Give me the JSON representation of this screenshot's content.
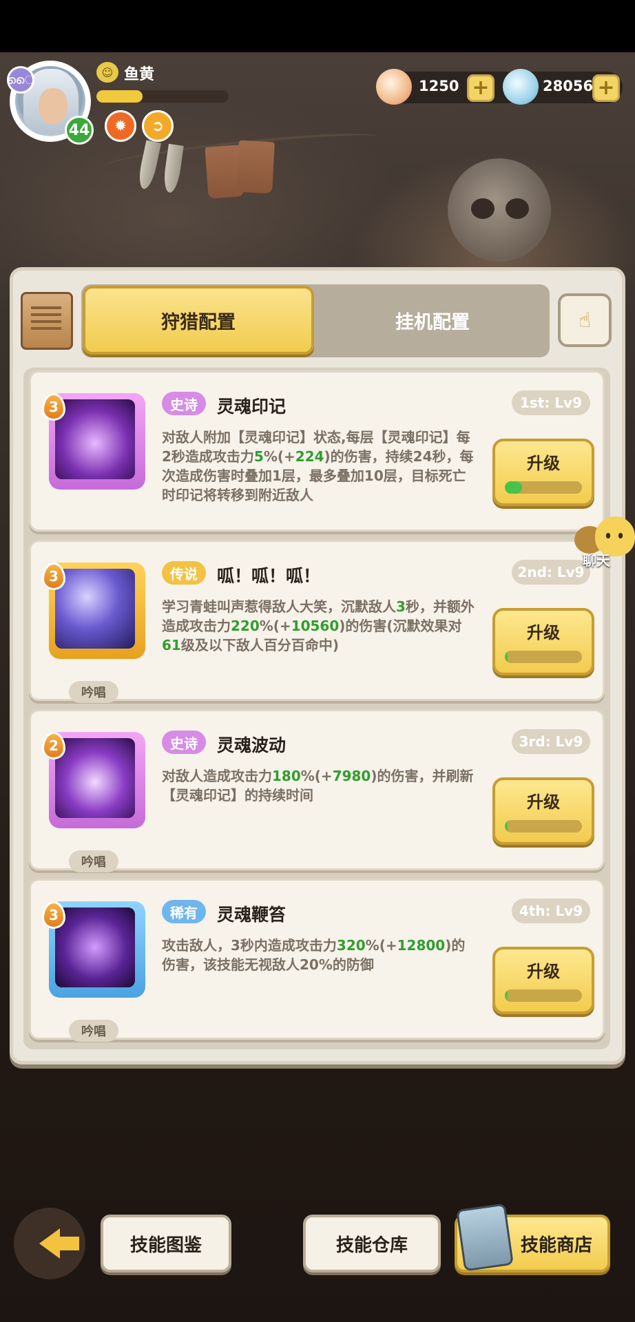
{
  "player": {
    "name": "鱼黄",
    "level": "44",
    "exp_fraction": 0.35
  },
  "currencies": [
    {
      "icon": "shell-icon",
      "value": "1250"
    },
    {
      "icon": "pearl-icon",
      "value": "28056"
    }
  ],
  "add_symbol": "+",
  "tabs": {
    "active": "狩猎配置",
    "inactive": "挂机配置"
  },
  "chat": {
    "label": "聊天"
  },
  "upgrade_label": "升级",
  "chant_label": "吟唱",
  "skills": [
    {
      "level": "3",
      "rarity": "史诗",
      "rarity_color": "#d68ce6",
      "name": "灵魂印记",
      "slot": "1st: Lv9",
      "has_chant": false,
      "progress": 0.22,
      "desc": [
        {
          "t": "对敌人附加【灵魂印记】状态,每层【灵魂印记】每2秒造成攻击力"
        },
        {
          "t": "5",
          "g": true
        },
        {
          "t": "%(+"
        },
        {
          "t": "224",
          "g": true
        },
        {
          "t": ")的伤害，持续24秒，每次造成伤害时叠加1层，最多叠加10层，目标死亡时印记将转移到附近敌人"
        }
      ]
    },
    {
      "level": "3",
      "rarity": "传说",
      "rarity_color": "#f1c244",
      "name": "呱！呱！呱！",
      "slot": "2nd: Lv9",
      "has_chant": true,
      "progress": 0.04,
      "desc": [
        {
          "t": "学习青蛙叫声惹得敌人大笑，沉默敌人"
        },
        {
          "t": "3",
          "g": true
        },
        {
          "t": "秒，并额外造成攻击力"
        },
        {
          "t": "220",
          "g": true
        },
        {
          "t": "%(+"
        },
        {
          "t": "10560",
          "g": true
        },
        {
          "t": ")的伤害(沉默效果对"
        },
        {
          "t": "61",
          "g": true
        },
        {
          "t": "级及以下敌人百分百命中)"
        }
      ]
    },
    {
      "level": "2",
      "rarity": "史诗",
      "rarity_color": "#d68ce6",
      "name": "灵魂波动",
      "slot": "3rd: Lv9",
      "has_chant": true,
      "progress": 0.04,
      "desc": [
        {
          "t": "对敌人造成攻击力"
        },
        {
          "t": "180",
          "g": true
        },
        {
          "t": "%(+"
        },
        {
          "t": "7980",
          "g": true
        },
        {
          "t": ")的伤害，并刷新【灵魂印记】的持续时间"
        }
      ]
    },
    {
      "level": "3",
      "rarity": "稀有",
      "rarity_color": "#6fb6ee",
      "name": "灵魂鞭笞",
      "slot": "4th: Lv9",
      "has_chant": true,
      "progress": 0.04,
      "desc": [
        {
          "t": "攻击敌人，3秒内造成攻击力"
        },
        {
          "t": "320",
          "g": true
        },
        {
          "t": "%(+"
        },
        {
          "t": "12800",
          "g": true
        },
        {
          "t": ")的伤害，该技能无视敌人20%的防御"
        }
      ]
    }
  ],
  "bottom": {
    "codex": "技能图鉴",
    "storage": "技能仓库",
    "shop": "技能商店"
  }
}
